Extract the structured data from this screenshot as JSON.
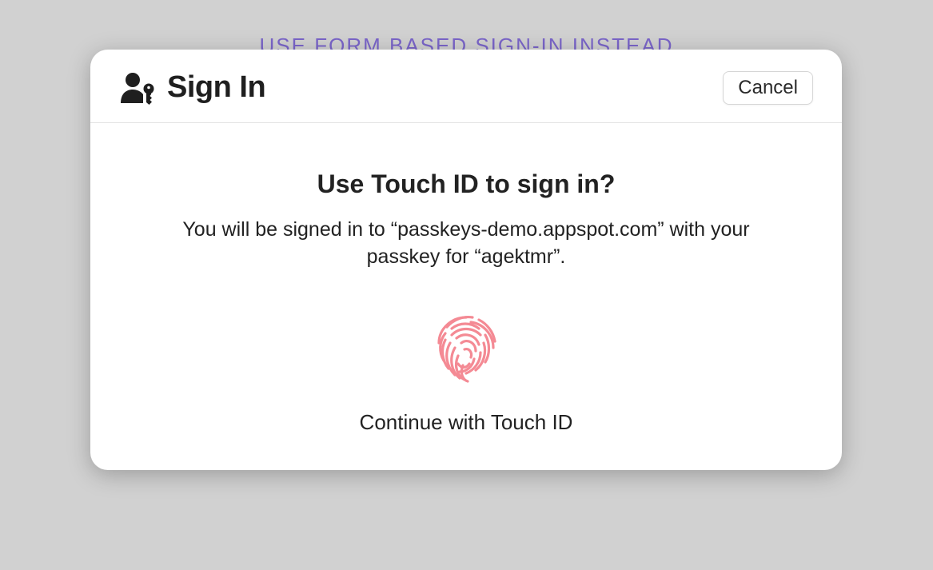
{
  "background": {
    "alt_signin_link": "USE FORM BASED SIGN-IN INSTEAD"
  },
  "dialog": {
    "title": "Sign In",
    "cancel_label": "Cancel",
    "prompt_heading": "Use Touch ID to sign in?",
    "prompt_description": "You will be signed in to “passkeys-demo.appspot.com” with your passkey for “agektmr”.",
    "continue_label": "Continue with Touch ID"
  },
  "colors": {
    "link": "#7a65c9",
    "fingerprint": "#f48a94"
  }
}
